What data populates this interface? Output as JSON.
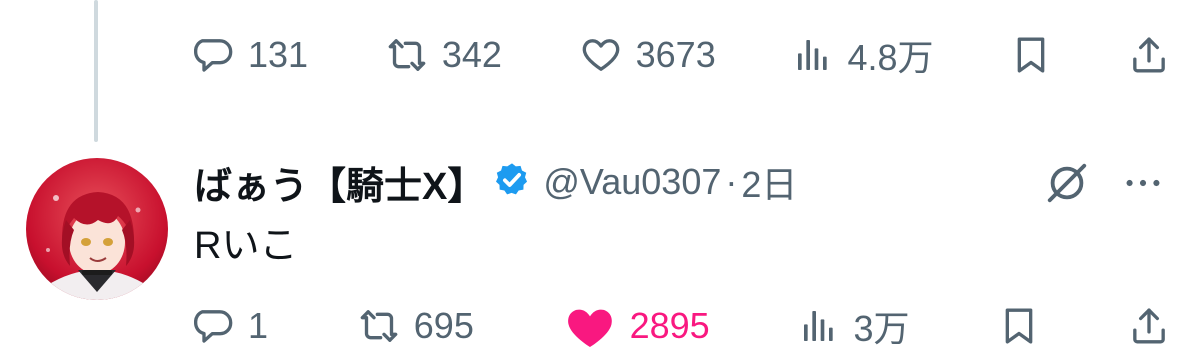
{
  "tweet_above": {
    "stats": {
      "replies": "131",
      "reposts": "342",
      "likes": "3673",
      "views": "4.8万"
    }
  },
  "tweet": {
    "author": {
      "display_name": "ばぁう【騎士X】",
      "handle": "@Vau0307",
      "verified": true
    },
    "separator": "·",
    "time": "2日",
    "text": "Rいこ",
    "stats": {
      "replies": "1",
      "reposts": "695",
      "likes": "2895",
      "views": "3万"
    },
    "liked": true
  },
  "icons": {
    "reply": "speech-bubble-icon",
    "repost": "repost-arrows-icon",
    "like": "heart-icon",
    "views": "bar-chart-icon",
    "bookmark": "bookmark-icon",
    "share": "share-upload-icon",
    "grok": "grok-icon",
    "more": "more-dots-icon",
    "verified": "verified-badge-icon"
  },
  "colors": {
    "text_primary": "#0f1419",
    "text_secondary": "#536471",
    "like_active": "#f91880",
    "verified_blue": "#1d9bf0",
    "thread_line": "#cfd9de"
  }
}
